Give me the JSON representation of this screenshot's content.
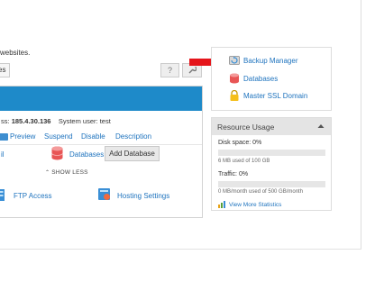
{
  "page": {
    "intro_text": "websites.",
    "sub_button": "es",
    "help_label": "?",
    "tools_label": "🔧"
  },
  "card": {
    "info_address_label": "ss:",
    "ip": "185.4.30.136",
    "system_user_label": "System user:",
    "system_user": "test",
    "actions": [
      "Preview",
      "Suspend",
      "Disable",
      "Description"
    ],
    "left_link": "il",
    "databases_link": "Databases",
    "add_database_button": "Add Database",
    "show_less": "SHOW LESS",
    "ftp_access": "FTP Access",
    "hosting_settings": "Hosting Settings"
  },
  "side_links": {
    "backup_manager": "Backup Manager",
    "databases": "Databases",
    "master_ssl": "Master SSL Domain"
  },
  "resource_usage": {
    "title": "Resource Usage",
    "disk_label": "Disk space: 0%",
    "disk_fraction": 0,
    "disk_note": "6 MB used of 100 GB",
    "traffic_label": "Traffic: 0%",
    "traffic_fraction": 0,
    "traffic_note": "0 MB/month used of 500 GB/month",
    "stats_link": "View More Statistics"
  },
  "colors": {
    "card_header": "#1e8ac9",
    "link": "#1e73be",
    "arrow": "#e5151b",
    "resource_header": "#e4e4e4"
  }
}
